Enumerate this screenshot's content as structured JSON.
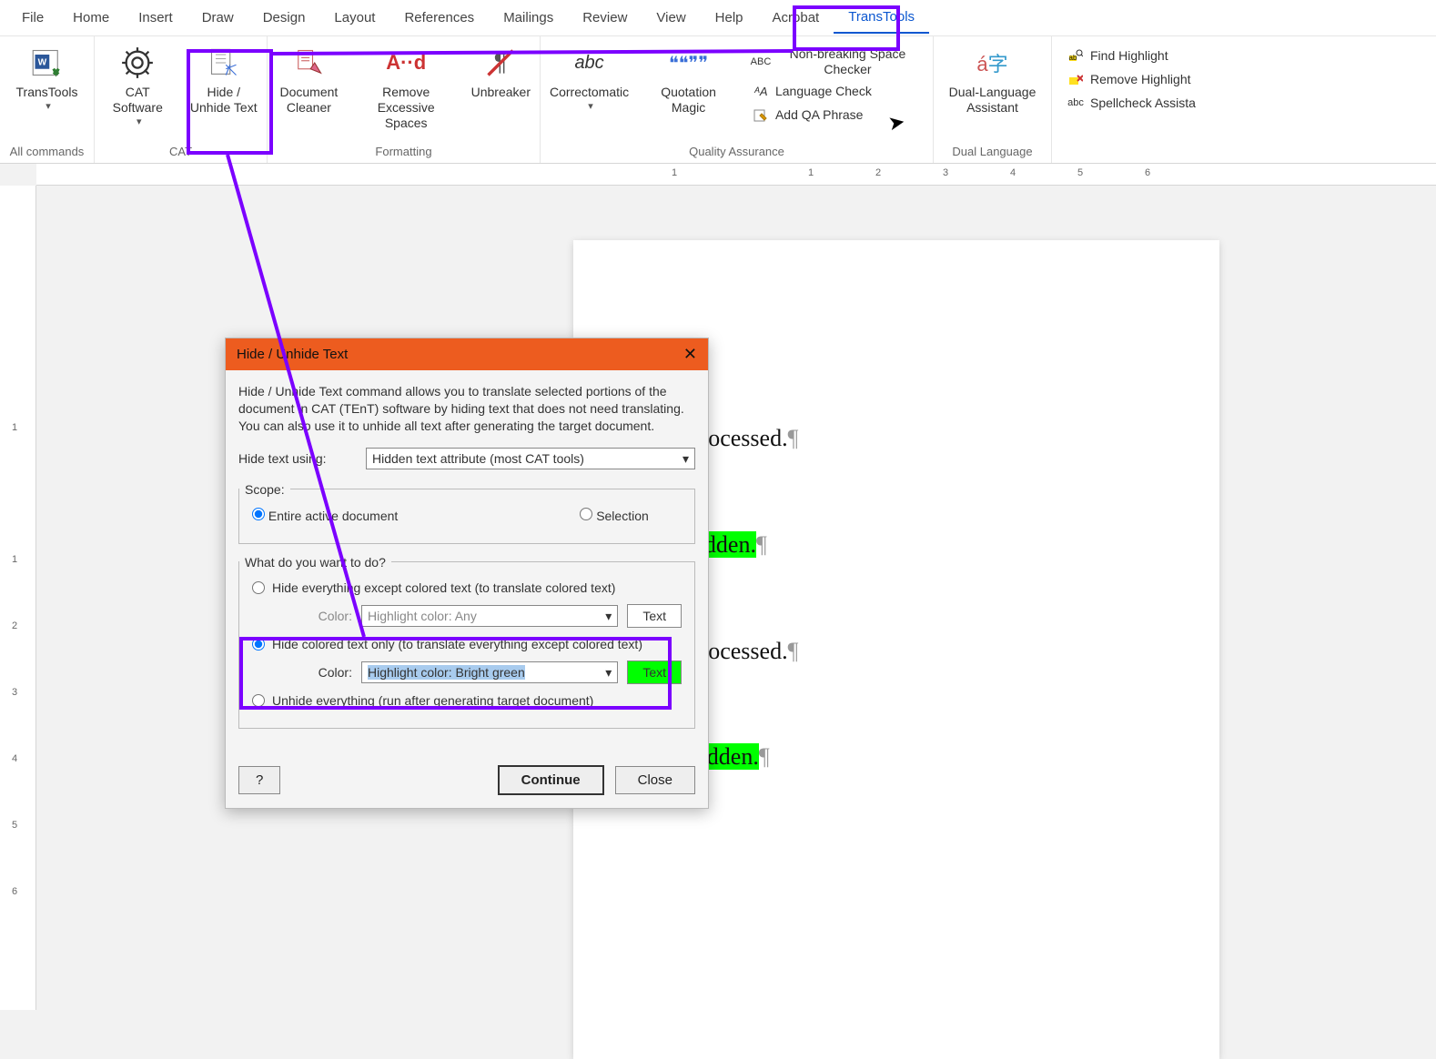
{
  "menu": {
    "items": [
      "File",
      "Home",
      "Insert",
      "Draw",
      "Design",
      "Layout",
      "References",
      "Mailings",
      "Review",
      "View",
      "Help",
      "Acrobat",
      "TransTools"
    ],
    "selected": "TransTools"
  },
  "ribbon": {
    "groups": [
      {
        "label": "All commands",
        "buttons": [
          {
            "label": "TransTools",
            "icon": "transtools"
          }
        ]
      },
      {
        "label": "CAT",
        "buttons": [
          {
            "label": "CAT Software",
            "icon": "gear"
          },
          {
            "label": "Hide / Unhide Text",
            "icon": "hide"
          }
        ]
      },
      {
        "label": "Formatting",
        "buttons": [
          {
            "label": "Document Cleaner",
            "icon": "broom"
          },
          {
            "label": "Remove Excessive Spaces",
            "icon": "aa"
          },
          {
            "label": "Unbreaker",
            "icon": "unbreak"
          }
        ]
      },
      {
        "label": "Quality Assurance",
        "buttons": [
          {
            "label": "Correctomatic",
            "icon": "abc"
          },
          {
            "label": "Quotation Magic",
            "icon": "quote"
          }
        ],
        "smalls": [
          {
            "label": "Non-breaking Space Checker",
            "icon": "abcu"
          },
          {
            "label": "Language Check",
            "icon": "lang"
          },
          {
            "label": "Add QA Phrase",
            "icon": "add"
          }
        ]
      },
      {
        "label": "Dual Language",
        "buttons": [
          {
            "label": "Dual-Language Assistant",
            "icon": "dual"
          }
        ]
      },
      {
        "label": "",
        "smalls": [
          {
            "label": "Find Highlight",
            "icon": "findhl"
          },
          {
            "label": "Remove Highlight",
            "icon": "remhl"
          },
          {
            "label": "Spellcheck Assista",
            "icon": "spell"
          }
        ]
      }
    ]
  },
  "ruler": {
    "marks": [
      "1",
      "1",
      "2",
      "3",
      "4",
      "5",
      "6"
    ]
  },
  "vruler": {
    "marks": [
      "1",
      "1",
      "2",
      "3",
      "4",
      "5",
      "6"
    ]
  },
  "doc": {
    "lines": [
      {
        "text": "Text·to·be·processed.",
        "hl": false
      },
      {
        "text": "",
        "hl": false
      },
      {
        "text": "Test·to·be·hidden.",
        "hl": true
      },
      {
        "text": "",
        "hl": false
      },
      {
        "text": "Text·to·be·processed.",
        "hl": false
      },
      {
        "text": "",
        "hl": false
      },
      {
        "text": "Text·to·be·hidden.",
        "hl": true
      }
    ]
  },
  "dialog": {
    "title": "Hide / Unhide Text",
    "desc": "Hide / Unhide Text command allows you to translate selected portions of the document in CAT (TEnT) software by hiding text that does not need translating. You can also use it to unhide all text after generating the target document.",
    "hide_using_label": "Hide text using:",
    "hide_using_value": "Hidden text attribute (most CAT tools)",
    "scope_legend": "Scope:",
    "scope_entire": "Entire active document",
    "scope_selection": "Selection",
    "what_legend": "What do you want to do?",
    "opt1": "Hide everything except colored text (to translate colored text)",
    "opt2": "Hide colored text only (to translate everything except colored text)",
    "opt3": "Unhide everything (run after generating target document)",
    "color_label": "Color:",
    "color_value_any": "Highlight color: Any",
    "color_value_green": "Highlight color: Bright green",
    "text_swatch": "Text",
    "help_btn": "?",
    "continue_btn": "Continue",
    "close_btn": "Close"
  }
}
